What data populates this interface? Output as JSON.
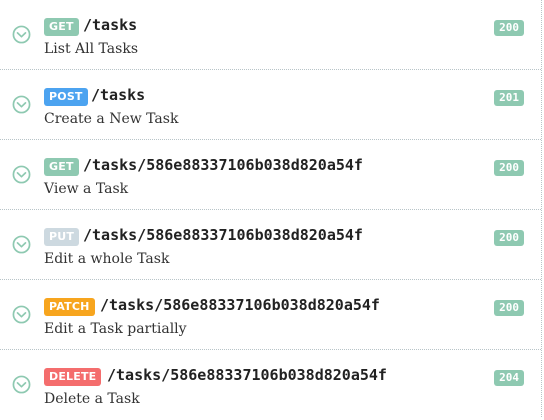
{
  "colors": {
    "get": "#8ec9b1",
    "post": "#4ca3f0",
    "put": "#cdd9e0",
    "patch": "#f7a51e",
    "delete": "#f46d6d",
    "status": "#8ec9b1",
    "chevron": "#8ec9b1"
  },
  "endpoints": [
    {
      "method": "GET",
      "path": "/tasks",
      "description": "List All Tasks",
      "status": "200",
      "method_icon": "chevron-down-icon"
    },
    {
      "method": "POST",
      "path": "/tasks",
      "description": "Create a New Task",
      "status": "201",
      "method_icon": "chevron-down-icon"
    },
    {
      "method": "GET",
      "path": "/tasks/586e88337106b038d820a54f",
      "description": "View a Task",
      "status": "200",
      "method_icon": "chevron-down-icon"
    },
    {
      "method": "PUT",
      "path": "/tasks/586e88337106b038d820a54f",
      "description": "Edit a whole Task",
      "status": "200",
      "method_icon": "chevron-down-icon"
    },
    {
      "method": "PATCH",
      "path": "/tasks/586e88337106b038d820a54f",
      "description": "Edit a Task partially",
      "status": "200",
      "method_icon": "chevron-down-icon"
    },
    {
      "method": "DELETE",
      "path": "/tasks/586e88337106b038d820a54f",
      "description": "Delete a Task",
      "status": "204",
      "method_icon": "chevron-down-icon"
    }
  ]
}
